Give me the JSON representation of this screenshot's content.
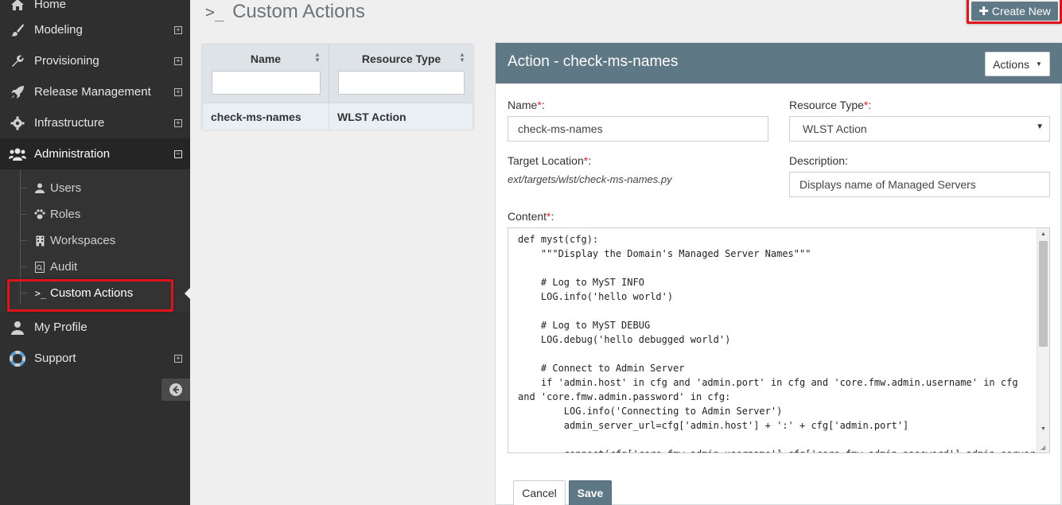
{
  "sidebar": {
    "items": [
      {
        "label": "Home",
        "icon": "home-icon"
      },
      {
        "label": "Modeling",
        "icon": "brush-icon",
        "expander": "⊞"
      },
      {
        "label": "Provisioning",
        "icon": "wrench-icon",
        "expander": "⊞"
      },
      {
        "label": "Release Management",
        "icon": "rocket-icon",
        "expander": "⊞"
      },
      {
        "label": "Infrastructure",
        "icon": "gear-icon",
        "expander": "⊞"
      },
      {
        "label": "Administration",
        "icon": "users-icon",
        "expander": "⊟"
      },
      {
        "label": "My Profile",
        "icon": "user-icon"
      },
      {
        "label": "Support",
        "icon": "lifebuoy-icon",
        "expander": "⊞"
      }
    ],
    "admin_children": [
      {
        "label": "Users",
        "icon": "user-icon"
      },
      {
        "label": "Roles",
        "icon": "paw-icon"
      },
      {
        "label": "Workspaces",
        "icon": "building-icon"
      },
      {
        "label": "Audit",
        "icon": "audit-icon"
      },
      {
        "label": "Custom Actions",
        "icon": "terminal-icon"
      }
    ]
  },
  "header": {
    "prompt": ">_",
    "title": "Custom Actions",
    "create_new": "Create New"
  },
  "grid": {
    "columns": [
      "Name",
      "Resource Type"
    ],
    "rows": [
      {
        "name": "check-ms-names",
        "resource_type": "WLST Action"
      }
    ]
  },
  "panel": {
    "title": "Action - check-ms-names",
    "actions_label": "Actions",
    "name_label": "Name",
    "name_value": "check-ms-names",
    "resource_type_label": "Resource Type",
    "resource_type_value": "WLST Action",
    "target_location_label": "Target Location",
    "target_location_value": "ext/targets/wlst/check-ms-names.py",
    "description_label": "Description:",
    "description_value": "Displays name of Managed Servers",
    "content_label": "Content",
    "content": "def myst(cfg):\n    \"\"\"Display the Domain's Managed Server Names\"\"\"\n\n    # Log to MyST INFO\n    LOG.info('hello world')\n\n    # Log to MyST DEBUG\n    LOG.debug('hello debugged world')\n\n    # Connect to Admin Server\n    if 'admin.host' in cfg and 'admin.port' in cfg and 'core.fmw.admin.username' in cfg\nand 'core.fmw.admin.password' in cfg:\n        LOG.info('Connecting to Admin Server')\n        admin_server_url=cfg['admin.host'] + ':' + cfg['admin.port']\n\n        connect(cfg['core.fmw.admin.username'],cfg['core.fmw.admin.password'],admin_server_url)",
    "cancel_label": "Cancel",
    "save_label": "Save"
  },
  "colors": {
    "sidebar_bg": "#2f2f2f",
    "accent": "#5f7885",
    "highlight": "#e0121a",
    "required": "#d9252a"
  }
}
